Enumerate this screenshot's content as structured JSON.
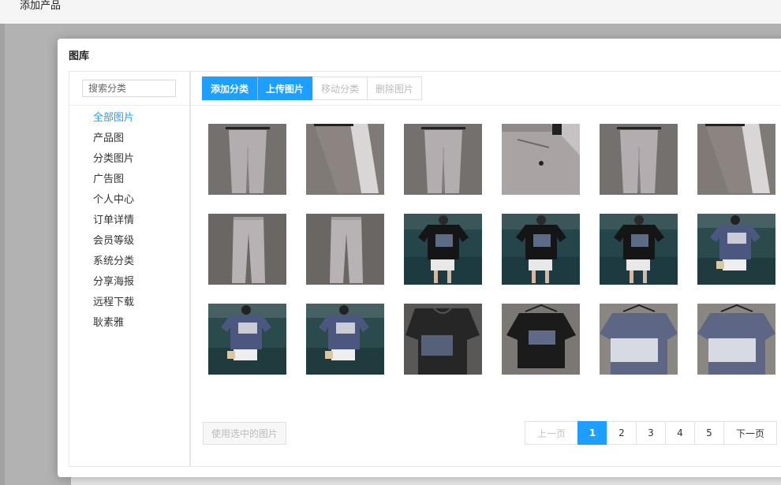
{
  "page": {
    "title": "添加产品"
  },
  "modal": {
    "title": "图库"
  },
  "sidebar": {
    "search_placeholder": "搜索分类",
    "categories": [
      {
        "label": "全部图片",
        "active": true
      },
      {
        "label": "产品图"
      },
      {
        "label": "分类图片"
      },
      {
        "label": "广告图"
      },
      {
        "label": "个人中心"
      },
      {
        "label": "订单详情"
      },
      {
        "label": "会员等级"
      },
      {
        "label": "系统分类"
      },
      {
        "label": "分享海报"
      },
      {
        "label": "远程下载"
      },
      {
        "label": "耿素雅"
      }
    ]
  },
  "toolbar": {
    "add_category": "添加分类",
    "upload_image": "上传图片",
    "move_category": "移动分类",
    "delete_image": "删除图片"
  },
  "images": [
    "grey-trousers-front",
    "trouser-leg-closeup",
    "grey-trousers-front",
    "trouser-pocket-closeup",
    "grey-trousers-front",
    "trouser-leg-closeup",
    "grey-trousers-flat",
    "grey-trousers-flat",
    "black-tshirt-model",
    "black-tshirt-model",
    "black-tshirt-model",
    "blue-tshirt-model",
    "blue-tshirt-model",
    "blue-tshirt-model",
    "black-tshirt-flat",
    "black-tshirt-hanger",
    "blue-tshirt-hanger",
    "blue-tshirt-hanger"
  ],
  "footer": {
    "use_selected": "使用选中的图片"
  },
  "pagination": {
    "prev": "上一页",
    "pages": [
      "1",
      "2",
      "3",
      "4",
      "5"
    ],
    "current": "1",
    "next": "下一页"
  },
  "colors": {
    "accent": "#1e9fff"
  }
}
